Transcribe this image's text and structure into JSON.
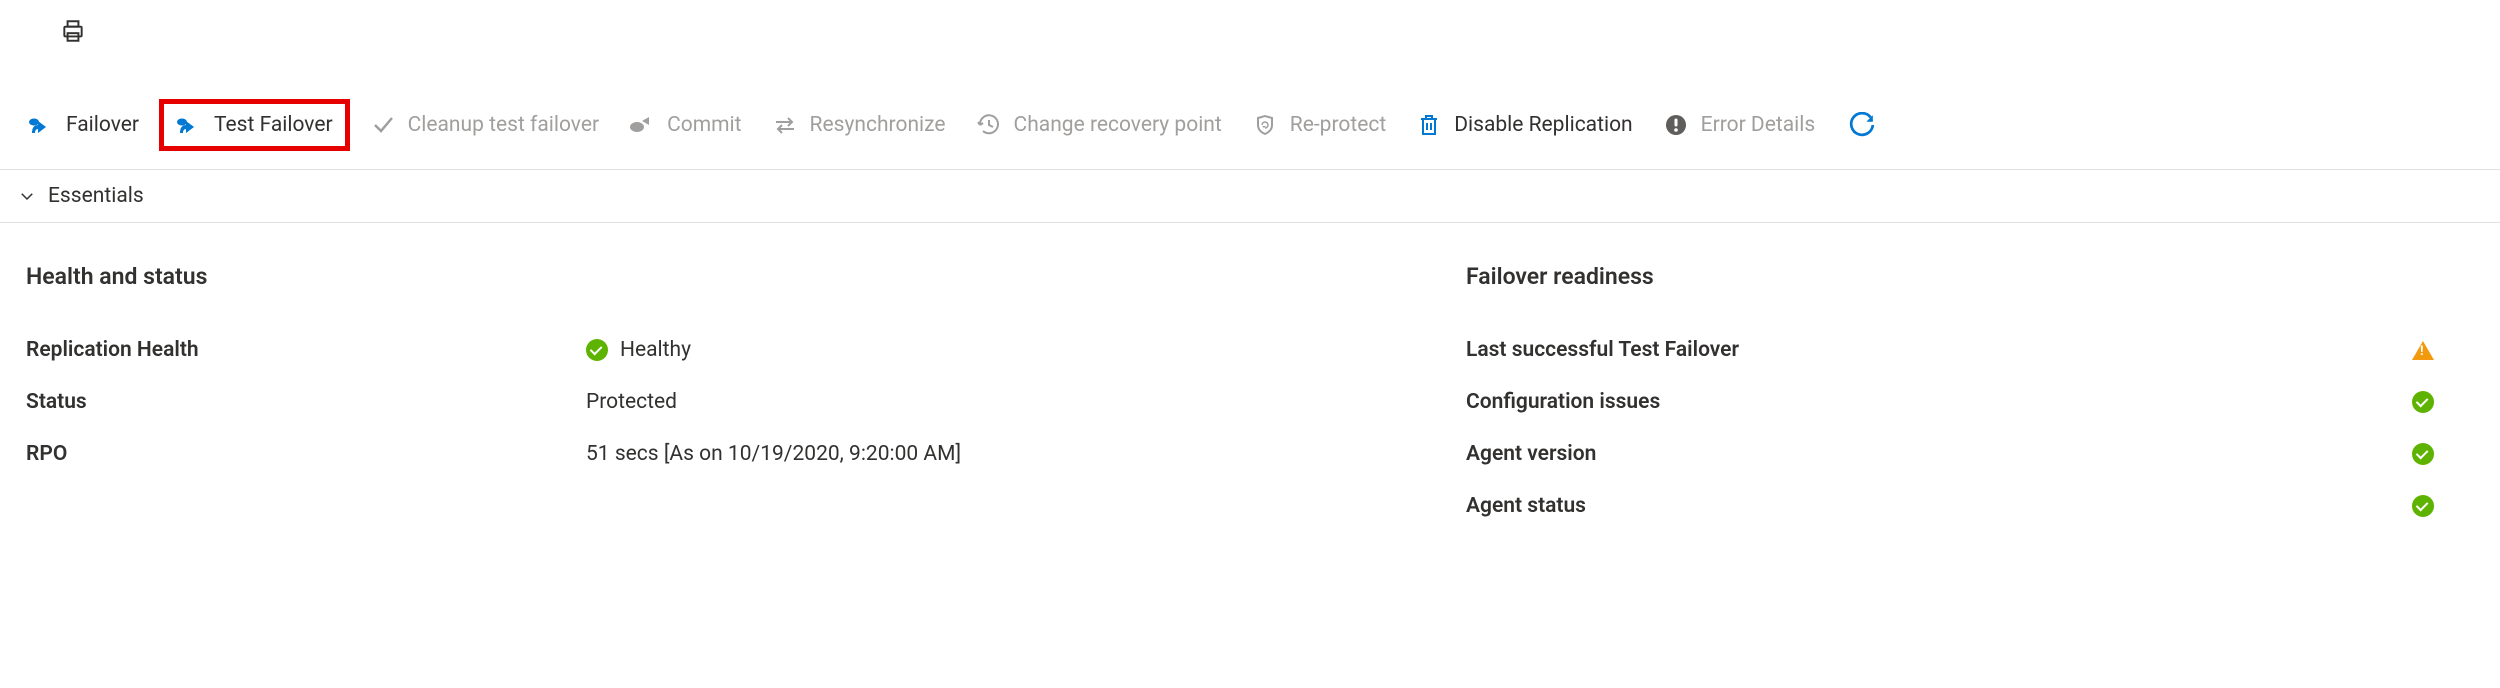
{
  "toolbar": {
    "failover": "Failover",
    "test_failover": "Test Failover",
    "cleanup": "Cleanup test failover",
    "commit": "Commit",
    "resync": "Resynchronize",
    "change_recovery": "Change recovery point",
    "reprotect": "Re-protect",
    "disable_replication": "Disable Replication",
    "error_details": "Error Details"
  },
  "essentials_label": "Essentials",
  "health_status": {
    "title": "Health and status",
    "replication_health_label": "Replication Health",
    "replication_health_value": "Healthy",
    "status_label": "Status",
    "status_value": "Protected",
    "rpo_label": "RPO",
    "rpo_value": "51 secs [As on 10/19/2020, 9:20:00 AM]"
  },
  "readiness": {
    "title": "Failover readiness",
    "last_test_failover": "Last successful Test Failover",
    "config_issues": "Configuration issues",
    "agent_version": "Agent version",
    "agent_status": "Agent status"
  },
  "colors": {
    "enabled_icon": "#0078d4",
    "disabled_icon": "#a19f9d",
    "delete_icon": "#0078d4",
    "error_icon": "#605e5c",
    "success": "#5db300",
    "warning": "#f2990e"
  }
}
